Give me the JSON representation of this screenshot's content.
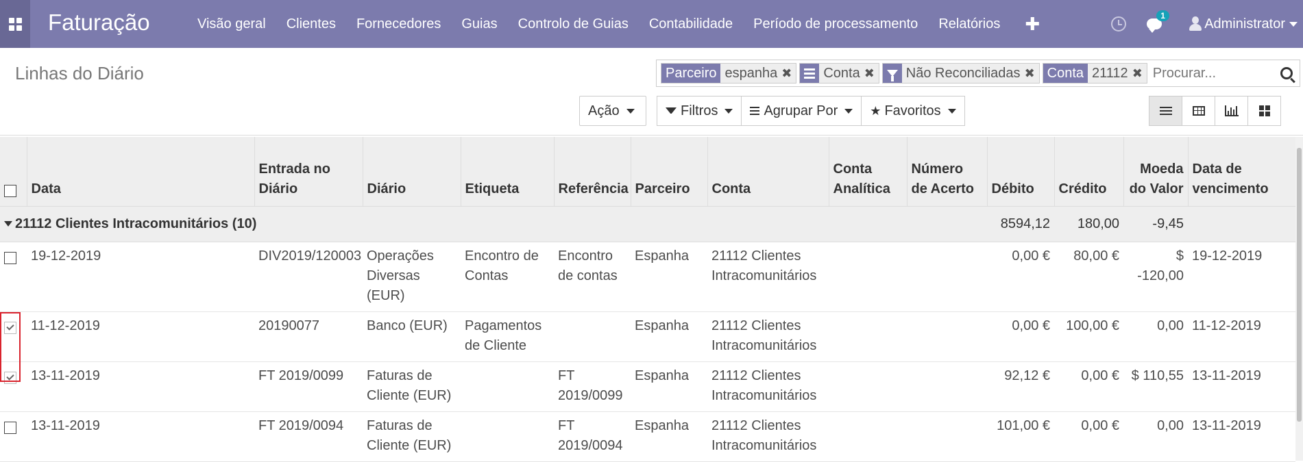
{
  "topbar": {
    "app_title": "Faturação",
    "menu": [
      "Visão geral",
      "Clientes",
      "Fornecedores",
      "Guias",
      "Controlo de Guias",
      "Contabilidade",
      "Período de processamento",
      "Relatórios"
    ],
    "plus": "✚",
    "messages_count": "1",
    "user_name": "Administrator",
    "accent_color": "#7c7bad"
  },
  "control_panel": {
    "title": "Linhas do Diário",
    "facets": [
      {
        "label": "Parceiro",
        "values": [
          "espanha"
        ]
      },
      {
        "label": "",
        "icon": "bars-icon",
        "values": [
          "Conta"
        ]
      },
      {
        "label": "",
        "icon": "filter-icon",
        "values": [
          "Não Reconciliadas"
        ]
      },
      {
        "label": "Conta",
        "values": [
          "21112"
        ]
      }
    ],
    "search_placeholder": "Procurar...",
    "action_button": "Ação",
    "filters_button": "Filtros",
    "groupby_button": "Agrupar Por",
    "favorites_button": "Favoritos"
  },
  "table": {
    "headers": [
      "Data",
      "Entrada no Diário",
      "Diário",
      "Etiqueta",
      "Referência",
      "Parceiro",
      "Conta",
      "Conta Analítica",
      "Número de Acerto",
      "Débito",
      "Crédito",
      "Moeda do Valor",
      "Data de vencimento"
    ],
    "group": {
      "label": "21112 Clientes Intracomunitários (10)",
      "debit": "8594,12",
      "credit": "180,00",
      "amount_currency": "-9,45"
    },
    "rows": [
      {
        "checked": false,
        "date": "19-12-2019",
        "entry": "DIV2019/120003",
        "journal": "Operações Diversas (EUR)",
        "label": "Encontro de Contas",
        "ref": "Encontro de contas",
        "partner": "Espanha",
        "account": "21112 Clientes Intracomunitários",
        "analytic": "",
        "matching": "",
        "debit": "0,00 €",
        "credit": "80,00 €",
        "amount_currency": "$ -120,00",
        "due": "19-12-2019"
      },
      {
        "checked": true,
        "date": "11-12-2019",
        "entry": "20190077",
        "journal": "Banco (EUR)",
        "label": "Pagamentos de Cliente",
        "ref": "",
        "partner": "Espanha",
        "account": "21112 Clientes Intracomunitários",
        "analytic": "",
        "matching": "",
        "debit": "0,00 €",
        "credit": "100,00 €",
        "amount_currency": "0,00",
        "due": "11-12-2019"
      },
      {
        "checked": true,
        "date": "13-11-2019",
        "entry": "FT 2019/0099",
        "journal": "Faturas de Cliente (EUR)",
        "label": "",
        "ref": "FT 2019/0099",
        "partner": "Espanha",
        "account": "21112 Clientes Intracomunitários",
        "analytic": "",
        "matching": "",
        "debit": "92,12 €",
        "credit": "0,00 €",
        "amount_currency": "$ 110,55",
        "due": "13-11-2019"
      },
      {
        "checked": false,
        "date": "13-11-2019",
        "entry": "FT 2019/0094",
        "journal": "Faturas de Cliente (EUR)",
        "label": "",
        "ref": "FT 2019/0094",
        "partner": "Espanha",
        "account": "21112 Clientes Intracomunitários",
        "analytic": "",
        "matching": "",
        "debit": "101,00 €",
        "credit": "0,00 €",
        "amount_currency": "0,00",
        "due": "13-11-2019"
      }
    ]
  }
}
